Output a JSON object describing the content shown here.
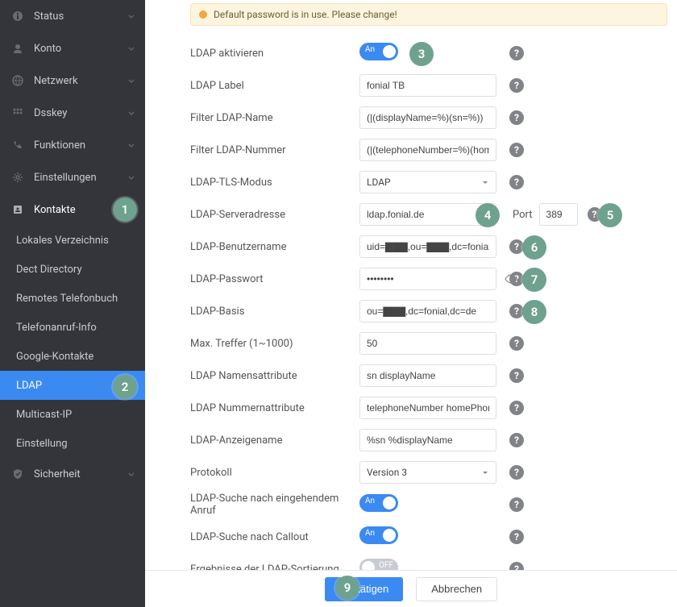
{
  "sidebar": {
    "items": [
      {
        "label": "Status"
      },
      {
        "label": "Konto"
      },
      {
        "label": "Netzwerk"
      },
      {
        "label": "Dsskey"
      },
      {
        "label": "Funktionen"
      },
      {
        "label": "Einstellungen"
      },
      {
        "label": "Kontakte"
      },
      {
        "label": "Sicherheit"
      }
    ],
    "sub": [
      {
        "label": "Lokales Verzeichnis"
      },
      {
        "label": "Dect Directory"
      },
      {
        "label": "Remotes Telefonbuch"
      },
      {
        "label": "Telefonanruf-Info"
      },
      {
        "label": "Google-Kontakte"
      },
      {
        "label": "LDAP"
      },
      {
        "label": "Multicast-IP"
      },
      {
        "label": "Einstellung"
      }
    ]
  },
  "warning": "Default password is in use. Please change!",
  "form": {
    "ldap_enable_label": "LDAP aktivieren",
    "ldap_label_label": "LDAP Label",
    "ldap_label_value": "fonial TB",
    "filter_name_label": "Filter LDAP-Name",
    "filter_name_value": "(|(displayName=%)(sn=%))",
    "filter_number_label": "Filter LDAP-Nummer",
    "filter_number_value": "(|(telephoneNumber=%)(homePhon",
    "tls_label": "LDAP-TLS-Modus",
    "tls_value": "LDAP",
    "server_label": "LDAP-Serveradresse",
    "server_value": "ldap.fonial.de",
    "port_label": "Port",
    "port_value": "389",
    "user_label": "LDAP-Benutzername",
    "user_value": "uid=▇▇▇,ou=▇▇▇,dc=fonial,dc",
    "password_label": "LDAP-Passwort",
    "password_value": "••••••••",
    "base_label": "LDAP-Basis",
    "base_value": "ou=▇▇▇,dc=fonial,dc=de",
    "maxhits_label": "Max. Treffer (1~1000)",
    "maxhits_value": "50",
    "nameattr_label": "LDAP Namensattribute",
    "nameattr_value": "sn displayName",
    "numattr_label": "LDAP Nummernattribute",
    "numattr_value": "telephoneNumber homePhone mob",
    "display_label": "LDAP-Anzeigename",
    "display_value": "%sn %displayName",
    "protocol_label": "Protokoll",
    "protocol_value": "Version 3",
    "incoming_label": "LDAP-Suche nach eingehendem Anruf",
    "callout_label": "LDAP-Suche nach Callout",
    "sort_label": "Ergebnisse der LDAP-Sortierung"
  },
  "toggle": {
    "on": "An",
    "off": "OFF"
  },
  "footer": {
    "confirm": "Bestätigen",
    "cancel": "Abbrechen"
  },
  "badges": [
    "1",
    "2",
    "3",
    "4",
    "5",
    "6",
    "7",
    "8",
    "9"
  ]
}
